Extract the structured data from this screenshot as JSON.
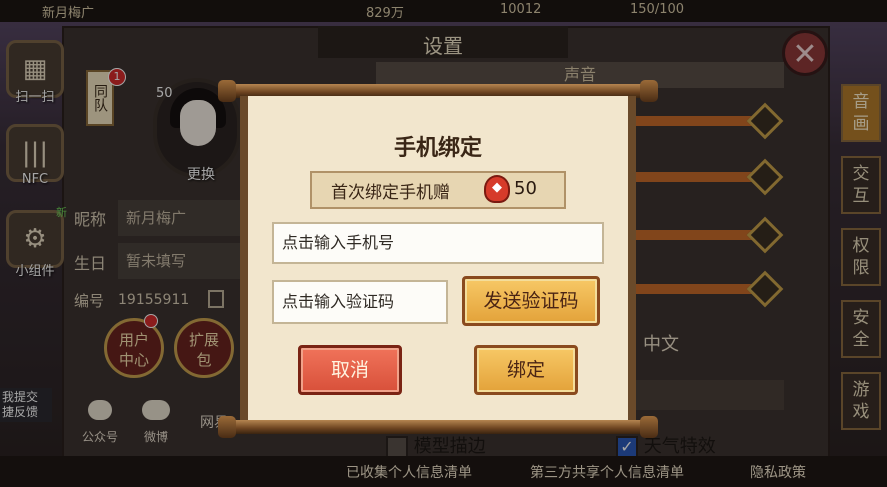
{
  "topbar": {
    "left_text": "新月梅广",
    "stat1": "829万",
    "stat2": "10012",
    "stat3": "150/100"
  },
  "settings": {
    "title": "设置",
    "sound_header": "声音",
    "language_value": "中文",
    "model_outline_label": "模型描边",
    "weather_effect_label": "天气特效",
    "model_outline_checked": false,
    "weather_effect_checked": true
  },
  "sidebar": {
    "items": [
      {
        "label": "扫一扫",
        "icon": "scan-icon"
      },
      {
        "label": "NFC",
        "icon": "nfc-icon"
      },
      {
        "label": "小组件",
        "icon": "widget-icon"
      }
    ],
    "new_tag": "新",
    "feedback_text": "我提交\n捷反馈"
  },
  "profile": {
    "team_tag": "同队",
    "team_badge": "1",
    "level": "50",
    "change_label": "更换",
    "nickname_label": "昵称",
    "nickname_value": "新月梅广",
    "birthday_label": "生日",
    "birthday_value": "暂未填写",
    "id_label": "编号",
    "id_value": "19155911",
    "user_center_label": "用户\n中心",
    "expansion_label": "扩展\n包",
    "wechat_label": "公众号",
    "weibo_label": "微博",
    "netease_label": "网易"
  },
  "right_tabs": [
    {
      "label": "音\n画",
      "active": true
    },
    {
      "label": "交\n互",
      "active": false
    },
    {
      "label": "权\n限",
      "active": false
    },
    {
      "label": "安\n全",
      "active": false
    },
    {
      "label": "游\n戏",
      "active": false
    }
  ],
  "footer": {
    "link1": "已收集个人信息清单",
    "link2": "第三方共享个人信息清单",
    "link3": "隐私政策"
  },
  "modal": {
    "title": "手机绑定",
    "reward_text": "首次绑定手机赠",
    "reward_icon": "fish-icon",
    "reward_count": "50",
    "phone_placeholder": "点击输入手机号",
    "code_placeholder": "点击输入验证码",
    "send_code_label": "发送验证码",
    "cancel_label": "取消",
    "bind_label": "绑定"
  },
  "colors": {
    "scroll_paper": "#f2e6cd",
    "button_gold": "#e3a23a",
    "button_red": "#d8503a",
    "badge_red": "#d62c2c"
  }
}
